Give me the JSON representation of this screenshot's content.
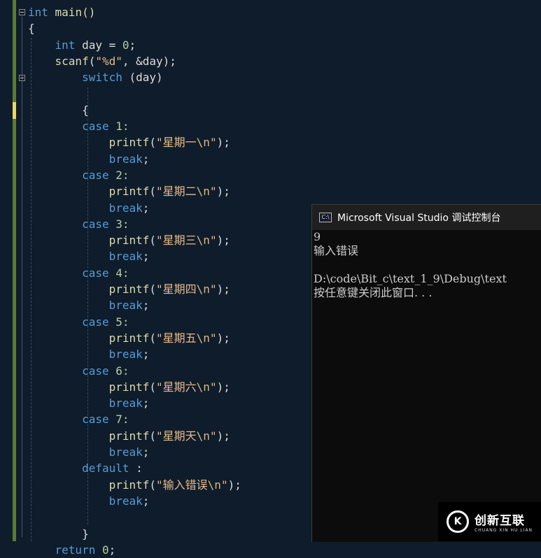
{
  "editor": {
    "lines": [
      [
        {
          "t": "int",
          "c": "kw"
        },
        {
          "t": " main()",
          "c": "fn"
        }
      ],
      [
        {
          "t": "{",
          "c": ""
        }
      ],
      [
        {
          "t": "    int",
          "c": "kw"
        },
        {
          "t": " day = ",
          "c": ""
        },
        {
          "t": "0",
          "c": "num"
        },
        {
          "t": ";",
          "c": ""
        }
      ],
      [
        {
          "t": "    scanf",
          "c": "fn"
        },
        {
          "t": "(",
          "c": ""
        },
        {
          "t": "\"%d\"",
          "c": "str"
        },
        {
          "t": ", &day);",
          "c": ""
        }
      ],
      [
        {
          "t": "        switch",
          "c": "kw"
        },
        {
          "t": " (day)",
          "c": ""
        }
      ],
      [
        {
          "t": "",
          "c": ""
        }
      ],
      [
        {
          "t": "        {",
          "c": ""
        }
      ],
      [
        {
          "t": "        case",
          "c": "kw"
        },
        {
          "t": " 1:",
          "c": "num"
        }
      ],
      [
        {
          "t": "            printf",
          "c": "fn"
        },
        {
          "t": "(",
          "c": ""
        },
        {
          "t": "\"星期一",
          "c": "str"
        },
        {
          "t": "\\n",
          "c": "esc"
        },
        {
          "t": "\"",
          "c": "str"
        },
        {
          "t": ");",
          "c": ""
        }
      ],
      [
        {
          "t": "            break",
          "c": "kw"
        },
        {
          "t": ";",
          "c": ""
        }
      ],
      [
        {
          "t": "        case",
          "c": "kw"
        },
        {
          "t": " 2:",
          "c": "num"
        }
      ],
      [
        {
          "t": "            printf",
          "c": "fn"
        },
        {
          "t": "(",
          "c": ""
        },
        {
          "t": "\"星期二",
          "c": "str"
        },
        {
          "t": "\\n",
          "c": "esc"
        },
        {
          "t": "\"",
          "c": "str"
        },
        {
          "t": ");",
          "c": ""
        }
      ],
      [
        {
          "t": "            break",
          "c": "kw"
        },
        {
          "t": ";",
          "c": ""
        }
      ],
      [
        {
          "t": "        case",
          "c": "kw"
        },
        {
          "t": " 3:",
          "c": "num"
        }
      ],
      [
        {
          "t": "            printf",
          "c": "fn"
        },
        {
          "t": "(",
          "c": ""
        },
        {
          "t": "\"星期三",
          "c": "str"
        },
        {
          "t": "\\n",
          "c": "esc"
        },
        {
          "t": "\"",
          "c": "str"
        },
        {
          "t": ");",
          "c": ""
        }
      ],
      [
        {
          "t": "            break",
          "c": "kw"
        },
        {
          "t": ";",
          "c": ""
        }
      ],
      [
        {
          "t": "        case",
          "c": "kw"
        },
        {
          "t": " 4:",
          "c": "num"
        }
      ],
      [
        {
          "t": "            printf",
          "c": "fn"
        },
        {
          "t": "(",
          "c": ""
        },
        {
          "t": "\"星期四",
          "c": "str"
        },
        {
          "t": "\\n",
          "c": "esc"
        },
        {
          "t": "\"",
          "c": "str"
        },
        {
          "t": ");",
          "c": ""
        }
      ],
      [
        {
          "t": "            break",
          "c": "kw"
        },
        {
          "t": ";",
          "c": ""
        }
      ],
      [
        {
          "t": "        case",
          "c": "kw"
        },
        {
          "t": " 5:",
          "c": "num"
        }
      ],
      [
        {
          "t": "            printf",
          "c": "fn"
        },
        {
          "t": "(",
          "c": ""
        },
        {
          "t": "\"星期五",
          "c": "str"
        },
        {
          "t": "\\n",
          "c": "esc"
        },
        {
          "t": "\"",
          "c": "str"
        },
        {
          "t": ");",
          "c": ""
        }
      ],
      [
        {
          "t": "            break",
          "c": "kw"
        },
        {
          "t": ";",
          "c": ""
        }
      ],
      [
        {
          "t": "        case",
          "c": "kw"
        },
        {
          "t": " 6:",
          "c": "num"
        }
      ],
      [
        {
          "t": "            printf",
          "c": "fn"
        },
        {
          "t": "(",
          "c": ""
        },
        {
          "t": "\"星期六",
          "c": "str"
        },
        {
          "t": "\\n",
          "c": "esc"
        },
        {
          "t": "\"",
          "c": "str"
        },
        {
          "t": ");",
          "c": ""
        }
      ],
      [
        {
          "t": "            break",
          "c": "kw"
        },
        {
          "t": ";",
          "c": ""
        }
      ],
      [
        {
          "t": "        case",
          "c": "kw"
        },
        {
          "t": " 7:",
          "c": "num"
        }
      ],
      [
        {
          "t": "            printf",
          "c": "fn"
        },
        {
          "t": "(",
          "c": ""
        },
        {
          "t": "\"星期天",
          "c": "str"
        },
        {
          "t": "\\n",
          "c": "esc"
        },
        {
          "t": "\"",
          "c": "str"
        },
        {
          "t": ");",
          "c": ""
        }
      ],
      [
        {
          "t": "            break",
          "c": "kw"
        },
        {
          "t": ";",
          "c": ""
        }
      ],
      [
        {
          "t": "        default",
          "c": "kw"
        },
        {
          "t": " :",
          "c": ""
        }
      ],
      [
        {
          "t": "            printf",
          "c": "fn"
        },
        {
          "t": "(",
          "c": ""
        },
        {
          "t": "\"输入错误",
          "c": "str"
        },
        {
          "t": "\\n",
          "c": "esc"
        },
        {
          "t": "\"",
          "c": "str"
        },
        {
          "t": ");",
          "c": ""
        }
      ],
      [
        {
          "t": "            break",
          "c": "kw"
        },
        {
          "t": ";",
          "c": ""
        }
      ],
      [
        {
          "t": "",
          "c": ""
        }
      ],
      [
        {
          "t": "        }",
          "c": ""
        }
      ],
      [
        {
          "t": "    return",
          "c": "kw"
        },
        {
          "t": " 0",
          "c": "num"
        },
        {
          "t": ";",
          "c": ""
        }
      ]
    ]
  },
  "console": {
    "title": "Microsoft Visual Studio 调试控制台",
    "icon_text": "C:\\",
    "lines": [
      "9",
      "输入错误",
      "",
      "D:\\code\\Bit_c\\text_1_9\\Debug\\text",
      "按任意键关闭此窗口. . ."
    ]
  },
  "watermark": {
    "logo_letter": "K",
    "name_cn": "创新互联",
    "name_en": "CHUANG XIN HU LIAN"
  },
  "colors": {
    "editor_bg": "#0f1c2b",
    "keyword": "#569cd6",
    "function": "#dcdcaa",
    "string": "#e6b98a",
    "console_bg": "#0c0c0c"
  }
}
